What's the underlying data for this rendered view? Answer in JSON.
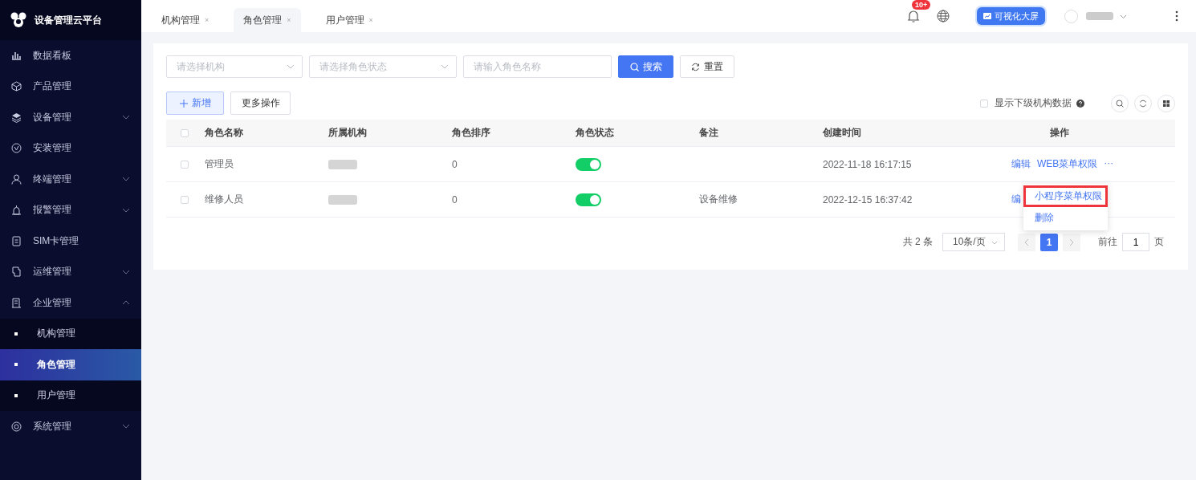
{
  "sidebar": {
    "title": "设备管理云平台",
    "items": [
      {
        "label": "数据看板",
        "kind": "chart"
      },
      {
        "label": "产品管理",
        "kind": "cube"
      },
      {
        "label": "设备管理",
        "kind": "layers",
        "expanded": false
      },
      {
        "label": "安装管理",
        "kind": "check"
      },
      {
        "label": "终端管理",
        "kind": "user",
        "expanded": false
      },
      {
        "label": "报警管理",
        "kind": "alarm",
        "expanded": false
      },
      {
        "label": "SIM卡管理",
        "kind": "card"
      },
      {
        "label": "运维管理",
        "kind": "tool",
        "expanded": false
      },
      {
        "label": "企业管理",
        "kind": "building",
        "expanded": true,
        "children": [
          {
            "label": "机构管理",
            "selected": false
          },
          {
            "label": "角色管理",
            "selected": true
          },
          {
            "label": "用户管理",
            "selected": false
          }
        ]
      },
      {
        "label": "系统管理",
        "kind": "gear",
        "expanded": false
      }
    ]
  },
  "tabs": [
    {
      "label": "机构管理",
      "close": "×",
      "selected": false
    },
    {
      "label": "角色管理",
      "close": "×",
      "selected": true
    },
    {
      "label": "用户管理",
      "close": "×",
      "selected": false
    }
  ],
  "header": {
    "notification_badge": "10+",
    "screen_button": "可视化大屏"
  },
  "filters": {
    "org_select": {
      "placeholder": "请选择机构"
    },
    "status_select": {
      "placeholder": "请选择角色状态"
    },
    "name_input": {
      "placeholder": "请输入角色名称"
    },
    "search_button": "搜索",
    "reset_button": "重置"
  },
  "actions": {
    "add_button": "新增",
    "more_button": "更多操作",
    "show_sub_orgs": {
      "label": "显示下级机构数据",
      "checked": false
    }
  },
  "table": {
    "all_checked": false,
    "columns": [
      "角色名称",
      "所属机构",
      "角色排序",
      "角色状态",
      "备注",
      "创建时间",
      "操作"
    ],
    "rows": [
      {
        "checked": false,
        "name": "管理员",
        "sort": "0",
        "enabled": true,
        "note": "",
        "created": "2022-11-18 16:17:15",
        "actions": [
          "编辑",
          "WEB菜单权限"
        ],
        "more": "···"
      },
      {
        "checked": false,
        "name": "维修人员",
        "sort": "0",
        "enabled": true,
        "note": "设备维修",
        "created": "2022-12-15 16:37:42",
        "actions": [
          "编"
        ]
      }
    ]
  },
  "dropdown": {
    "items": [
      {
        "label": "小程序菜单权限",
        "highlighted": true
      },
      {
        "label": "删除",
        "highlighted": false
      }
    ]
  },
  "pagination": {
    "total": "共 2 条",
    "page_size": "10条/页",
    "pages": [
      {
        "label": "1",
        "selected": true
      }
    ],
    "jump_label": "前往",
    "jump_value": "1",
    "jump_suffix": "页"
  }
}
